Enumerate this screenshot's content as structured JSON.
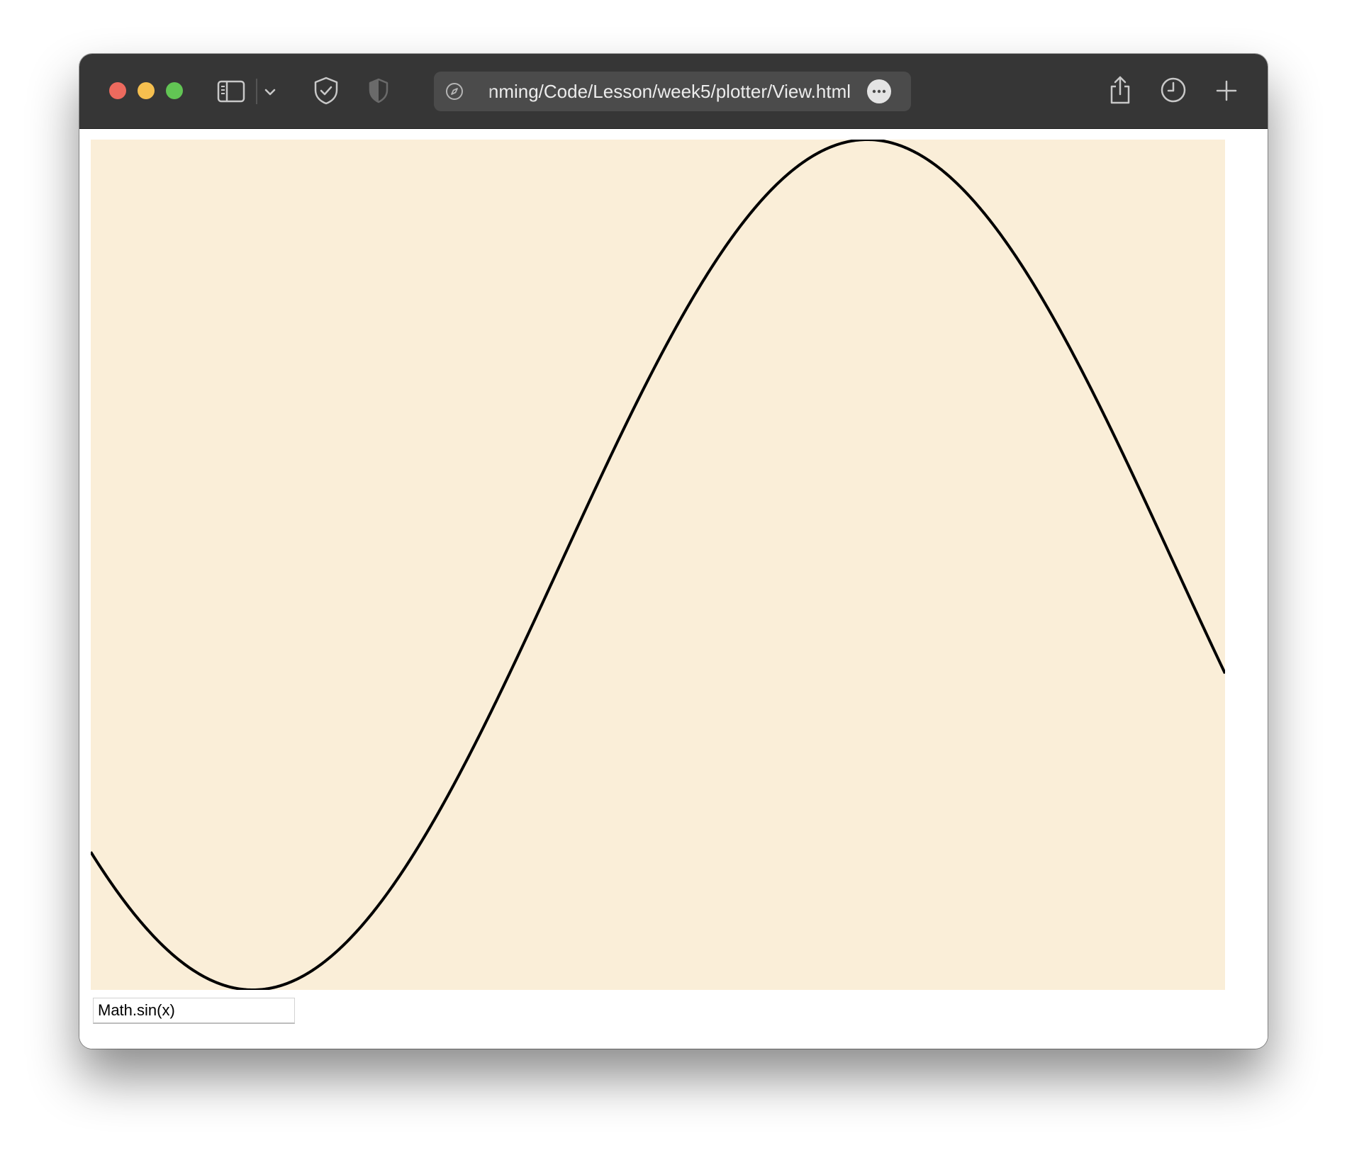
{
  "colors": {
    "toolbar_bg": "#363636",
    "url_bar_bg": "#4b4b4b",
    "close": "#ed6a5e",
    "minimize": "#f5bf4f",
    "maximize": "#62c554",
    "plot_bg": "#faeed8",
    "curve": "#000000"
  },
  "toolbar": {
    "traffic_lights": [
      "close",
      "minimize",
      "maximize"
    ],
    "icons": {
      "sidebar": "sidebar-icon",
      "sidebar_menu": "chevron-down-icon",
      "privacy": "shield-check-icon",
      "privacy_secondary": "shield-half-icon",
      "share": "share-icon",
      "history": "clock-icon",
      "new_tab": "plus-icon"
    },
    "url": {
      "text": "nming/Code/Lesson/week5/plotter/View.html",
      "leading_icon": "compass-icon",
      "trailing_icon": "more-icon"
    }
  },
  "plotter": {
    "function_input": "Math.sin(x)"
  },
  "chart_data": {
    "type": "line",
    "function": "Math.sin(x)",
    "series": [
      {
        "x": [
          -2.4,
          -2.0,
          -1.5708,
          -1.0,
          -0.5,
          0.0,
          0.5,
          1.0,
          1.5708,
          2.0,
          2.5,
          3.0,
          3.4
        ],
        "y": [
          -0.6755,
          -0.9093,
          -1.0,
          -0.8415,
          -0.4794,
          0.0,
          0.4794,
          0.8415,
          1.0,
          0.9093,
          0.5985,
          0.1411,
          -0.2555
        ]
      }
    ],
    "xlim": [
      -2.4,
      3.4
    ],
    "ylim": [
      -1.0,
      1.0
    ],
    "grid": false,
    "axes_visible": false
  }
}
